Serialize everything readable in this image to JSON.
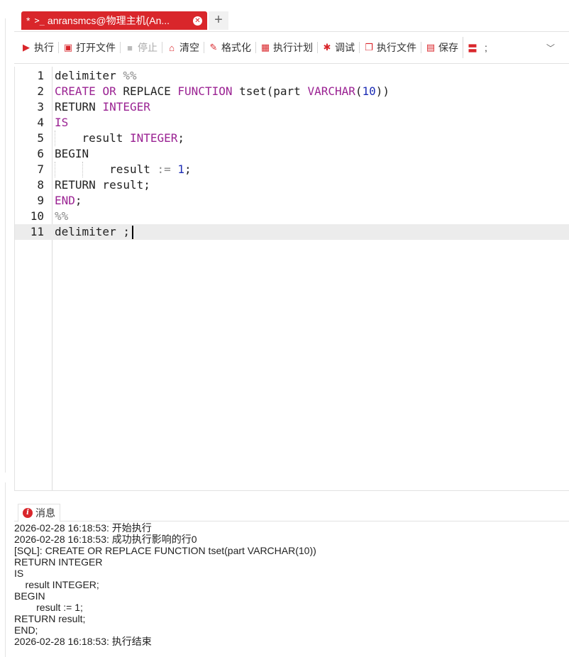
{
  "tab": {
    "modified_marker": "*",
    "terminal_icon": "terminal-icon",
    "title": "anransmcs@物理主机(An...",
    "close_icon": "close-icon",
    "add_icon": "plus-icon",
    "add_symbol": "+"
  },
  "toolbar": {
    "execute": "执行",
    "open_file": "打开文件",
    "stop": "停止",
    "clear": "清空",
    "format": "格式化",
    "exec_plan": "执行计划",
    "debug": "调试",
    "exec_file": "执行文件",
    "save": "保存",
    "delimiter": ";",
    "more_icon": "chevron-down-icon"
  },
  "editor": {
    "active_line": 11,
    "lines": [
      {
        "n": "1",
        "text": "delimiter %%"
      },
      {
        "n": "2",
        "text": "CREATE OR REPLACE FUNCTION tset(part VARCHAR(10))"
      },
      {
        "n": "3",
        "text": "RETURN INTEGER"
      },
      {
        "n": "4",
        "text": "IS"
      },
      {
        "n": "5",
        "text": "    result INTEGER;"
      },
      {
        "n": "6",
        "text": "BEGIN"
      },
      {
        "n": "7",
        "text": "        result := 1;"
      },
      {
        "n": "8",
        "text": "RETURN result;"
      },
      {
        "n": "9",
        "text": "END;"
      },
      {
        "n": "10",
        "text": "%%"
      },
      {
        "n": "11",
        "text": "delimiter ;"
      }
    ]
  },
  "messages": {
    "tab_label": "消息",
    "lines": [
      "2026-02-28 16:18:53: 开始执行",
      "2026-02-28 16:18:53: 成功执行影响的行0",
      "[SQL]: CREATE OR REPLACE FUNCTION tset(part VARCHAR(10))",
      "RETURN INTEGER",
      "IS",
      "    result INTEGER;",
      "BEGIN",
      "        result := 1;",
      "RETURN result;",
      "END;",
      "2026-02-28 16:18:53: 执行结束"
    ]
  },
  "colors": {
    "accent": "#d9262b",
    "keyword": "#9b2393",
    "number": "#1d2db5",
    "active_line_bg": "#ececec"
  }
}
